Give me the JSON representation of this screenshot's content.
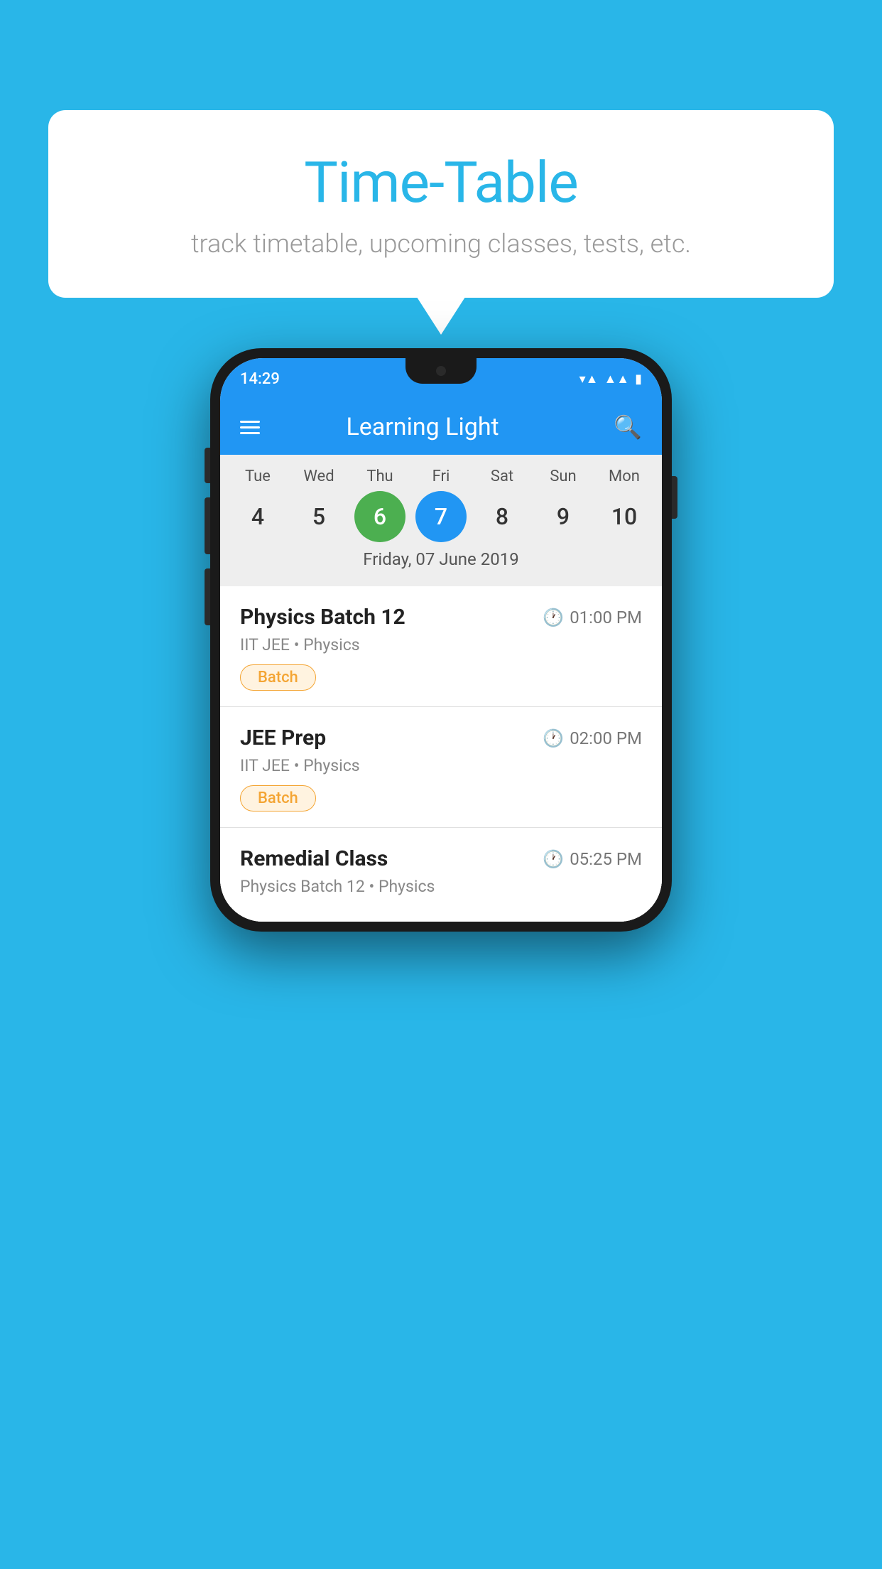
{
  "background": {
    "color": "#29b6e8"
  },
  "bubble": {
    "title": "Time-Table",
    "subtitle": "track timetable, upcoming classes, tests, etc."
  },
  "phone": {
    "status_bar": {
      "time": "14:29"
    },
    "app_bar": {
      "title": "Learning Light",
      "menu_label": "Menu",
      "search_label": "Search"
    },
    "calendar": {
      "days": [
        {
          "label": "Tue",
          "num": "4"
        },
        {
          "label": "Wed",
          "num": "5"
        },
        {
          "label": "Thu",
          "num": "6",
          "state": "today"
        },
        {
          "label": "Fri",
          "num": "7",
          "state": "selected"
        },
        {
          "label": "Sat",
          "num": "8"
        },
        {
          "label": "Sun",
          "num": "9"
        },
        {
          "label": "Mon",
          "num": "10"
        }
      ],
      "selected_date": "Friday, 07 June 2019"
    },
    "schedule": [
      {
        "title": "Physics Batch 12",
        "time": "01:00 PM",
        "sub": "IIT JEE • Physics",
        "badge": "Batch"
      },
      {
        "title": "JEE Prep",
        "time": "02:00 PM",
        "sub": "IIT JEE • Physics",
        "badge": "Batch"
      },
      {
        "title": "Remedial Class",
        "time": "05:25 PM",
        "sub": "Physics Batch 12 • Physics",
        "badge": ""
      }
    ]
  }
}
